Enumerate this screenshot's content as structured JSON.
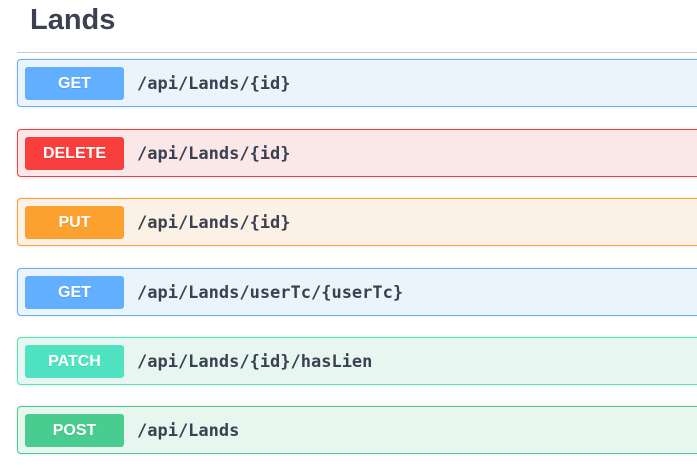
{
  "tag": {
    "title": "Lands"
  },
  "operations": [
    {
      "method": "GET",
      "path": "/api/Lands/{id}",
      "color": "#61affe",
      "bg": "#ebf3fb",
      "border": "#61affe"
    },
    {
      "method": "DELETE",
      "path": "/api/Lands/{id}",
      "color": "#f93e3e",
      "bg": "#fae7e7",
      "border": "#f93e3e"
    },
    {
      "method": "PUT",
      "path": "/api/Lands/{id}",
      "color": "#fca130",
      "bg": "#fbf1e6",
      "border": "#fca130"
    },
    {
      "method": "GET",
      "path": "/api/Lands/userTc/{userTc}",
      "color": "#61affe",
      "bg": "#ebf3fb",
      "border": "#61affe"
    },
    {
      "method": "PATCH",
      "path": "/api/Lands/{id}/hasLien",
      "color": "#50e3c2",
      "bg": "#e8f6f1",
      "border": "#50e3c2"
    },
    {
      "method": "POST",
      "path": "/api/Lands",
      "color": "#49cc90",
      "bg": "#e8f6f0",
      "border": "#49cc90"
    }
  ]
}
